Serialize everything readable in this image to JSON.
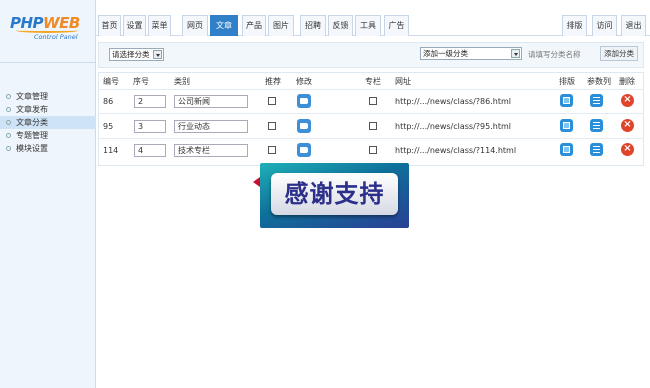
{
  "logo": {
    "brand_a": "PHP",
    "brand_b": "WEB",
    "subtitle": "Control Panel"
  },
  "sidebar": {
    "items": [
      {
        "label": "文章管理",
        "active": false
      },
      {
        "label": "文章发布",
        "active": false
      },
      {
        "label": "文章分类",
        "active": true
      },
      {
        "label": "专题管理",
        "active": false
      },
      {
        "label": "模块设置",
        "active": false
      }
    ]
  },
  "tabs": {
    "main": [
      "首页",
      "设置",
      "菜单",
      "网页",
      "文章",
      "产品",
      "图片",
      "招聘",
      "反馈",
      "工具",
      "广告"
    ],
    "active": "文章",
    "right": [
      "排版",
      "访问",
      "退出"
    ]
  },
  "filter": {
    "category_select": "请选择分类",
    "parent_select": "添加一级分类",
    "name_placeholder": "请填写分类名称",
    "add_button": "添加分类"
  },
  "table": {
    "headers": {
      "id": "编号",
      "order": "序号",
      "name": "类别",
      "recommend": "推荐",
      "edit": "修改",
      "column": "专栏",
      "url": "网址",
      "layout": "排版",
      "params": "参数列",
      "delete": "删除"
    },
    "rows": [
      {
        "id": "86",
        "order": "2",
        "name": "公司新闻",
        "url": "http://.../news/class/?86.html"
      },
      {
        "id": "95",
        "order": "3",
        "name": "行业动态",
        "url": "http://.../news/class/?95.html"
      },
      {
        "id": "114",
        "order": "4",
        "name": "技术专栏",
        "url": "http://.../news/class/?114.html"
      }
    ]
  },
  "overlay": {
    "text": "感谢支持"
  },
  "colors": {
    "accent": "#2f7fc9",
    "delete": "#e0452c",
    "overlay_text": "#2c2f8a"
  }
}
